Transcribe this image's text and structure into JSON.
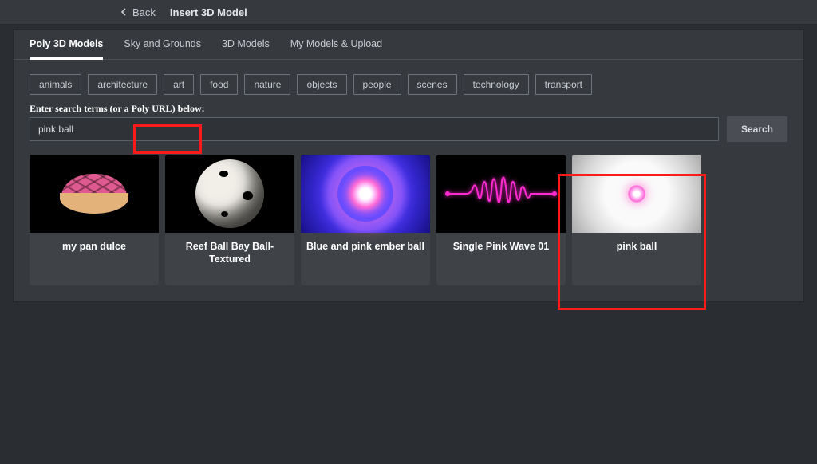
{
  "header": {
    "back_label": "Back",
    "title": "Insert 3D Model"
  },
  "tabs": [
    {
      "label": "Poly 3D Models",
      "active": true
    },
    {
      "label": "Sky and Grounds",
      "active": false
    },
    {
      "label": "3D Models",
      "active": false
    },
    {
      "label": "My Models & Upload",
      "active": false
    }
  ],
  "categories": [
    "animals",
    "architecture",
    "art",
    "food",
    "nature",
    "objects",
    "people",
    "scenes",
    "technology",
    "transport"
  ],
  "search": {
    "label": "Enter search terms (or a Poly URL) below:",
    "value": "pink ball",
    "button": "Search"
  },
  "results": [
    {
      "title": "my pan dulce"
    },
    {
      "title": "Reef Ball Bay Ball-Textured"
    },
    {
      "title": "Blue and pink ember ball"
    },
    {
      "title": "Single Pink Wave 01"
    },
    {
      "title": "pink ball"
    }
  ],
  "highlights": {
    "search_box": true,
    "result_index": 4
  }
}
